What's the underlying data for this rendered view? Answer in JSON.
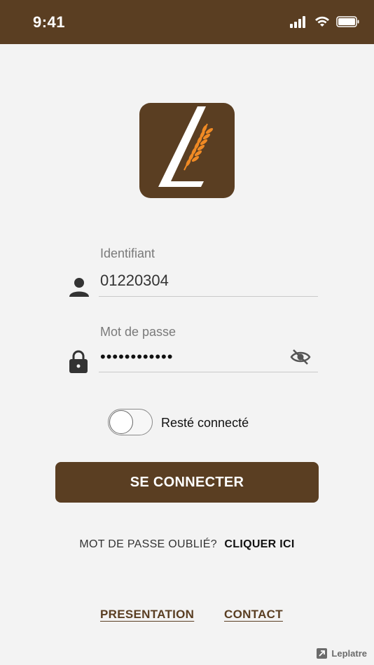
{
  "status_bar": {
    "time": "9:41",
    "icons": [
      "cellular-signal-icon",
      "wifi-icon",
      "battery-icon"
    ]
  },
  "login": {
    "logo_icon": "leplatre-logo-icon",
    "identifiant_label": "Identifiant",
    "identifiant_value": "01220304",
    "password_label": "Mot de passe",
    "password_masked": "••••••••••••",
    "stay_connected_label": "Resté connecté",
    "stay_connected_on": false,
    "submit_label": "SE CONNECTER",
    "forgot_text": "MOT DE PASSE OUBLIÉ?",
    "forgot_link": "CLIQUER ICI"
  },
  "footer": {
    "presentation": "PRESENTATION",
    "contact": "CONTACT",
    "brand": "Leplatre"
  },
  "colors": {
    "brand_brown": "#5a3e22",
    "accent_orange": "#f08a24",
    "background": "#f3f3f3"
  }
}
